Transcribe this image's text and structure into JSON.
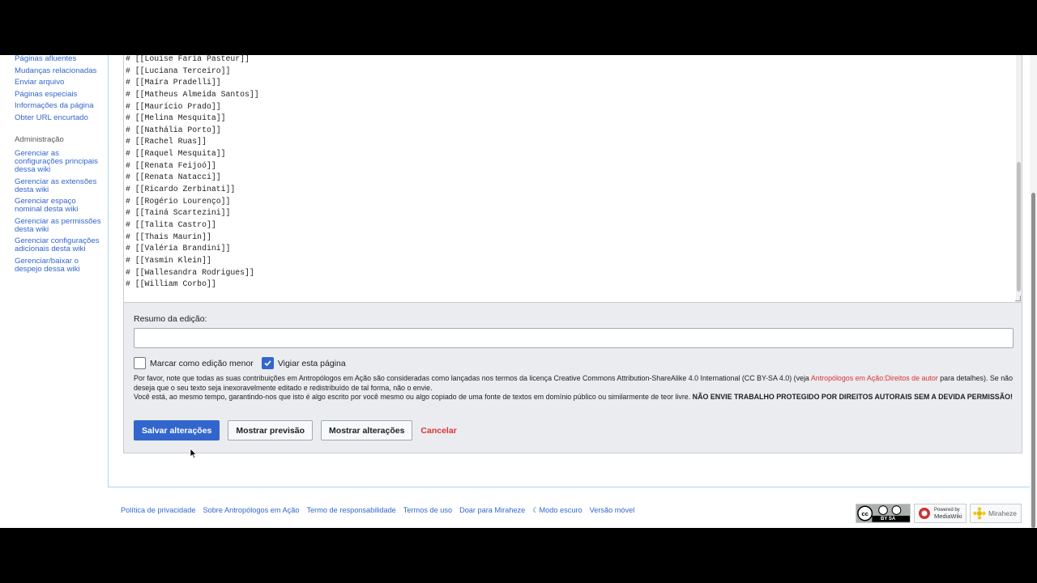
{
  "sidebar": {
    "tools": [
      "Páginas afluentes",
      "Mudanças relacionadas",
      "Enviar arquivo",
      "Páginas especiais",
      "Informações da página",
      "Obter URL encurtado"
    ],
    "admin_heading": "Administração",
    "admin": [
      "Gerenciar as configurações principais dessa wiki",
      "Gerenciar as extensões desta wiki",
      "Gerenciar espaço nominal desta wiki",
      "Gerenciar as permissões desta wiki",
      "Gerenciar configurações adicionais desta wiki",
      "Gerenciar/baixar o despejo dessa wiki"
    ]
  },
  "editor": {
    "lines": [
      "# [[Louise Faria Pasteur]]",
      "# [[Luciana Terceiro]]",
      "# [[Maíra Pradelli]]",
      "# [[Matheus Almeida Santos]]",
      "# [[Maurício Prado]]",
      "# [[Melina Mesquita]]",
      "# [[Nathália Porto]]",
      "# [[Rachel Ruas]]",
      "# [[Raquel Mesquita]]",
      "# [[Renata Feijoó]]",
      "# [[Renata Natacci]]",
      "# [[Ricardo Zerbinati]]",
      "# [[Rogério Lourenço]]",
      "# [[Tainá Scartezini]]",
      "# [[Talita Castro]]",
      "# [[Thais Maurin]]",
      "# [[Valéria Brandini]]",
      "# [[Yasmin Klein]]",
      "# [[Wallesandra Rodrigues]]",
      "# [[William Corbo]]"
    ]
  },
  "options": {
    "summary_label": "Resumo da edição:",
    "summary_value": "",
    "minor_label": "Marcar como edição menor",
    "minor_checked": false,
    "watch_label": "Vigiar esta página",
    "watch_checked": true,
    "notice_1": "Por favor, note que todas as suas contribuições em Antropólogos em Ação são consideradas como lançadas nos termos da licença Creative Commons Attribution-ShareAlike 4.0 International (CC BY-SA 4.0) (veja ",
    "notice_link": "Antropólogos em Ação:Direitos de autor",
    "notice_2": " para detalhes). Se não deseja que o seu texto seja inexoravelmente editado e redistribuído de tal forma, não o envie.",
    "notice_3": "Você está, ao mesmo tempo, garantindo-nos que isto é algo escrito por você mesmo ou algo copiado de uma fonte de textos em domínio público ou similarmente de teor livre. ",
    "notice_bold": "NÃO ENVIE TRABALHO PROTEGIDO POR DIREITOS AUTORAIS SEM A DEVIDA PERMISSÃO!"
  },
  "buttons": {
    "save": "Salvar alterações",
    "preview": "Mostrar previsão",
    "changes": "Mostrar alterações",
    "cancel": "Cancelar"
  },
  "footer": {
    "links": [
      "Política de privacidade",
      "Sobre Antropólogos em Ação",
      "Termo de responsabilidade",
      "Termos de uso",
      "Doar para Miraheze",
      "☾Modo escuro",
      "Versão móvel"
    ],
    "badges": {
      "cc": "BY SA",
      "mediawiki_top": "Powered by",
      "mediawiki_bottom": "MediaWiki",
      "miraheze": "Miraheze"
    }
  },
  "colors": {
    "link": "#3366cc",
    "primary": "#3366cc",
    "destructive": "#d33333"
  }
}
